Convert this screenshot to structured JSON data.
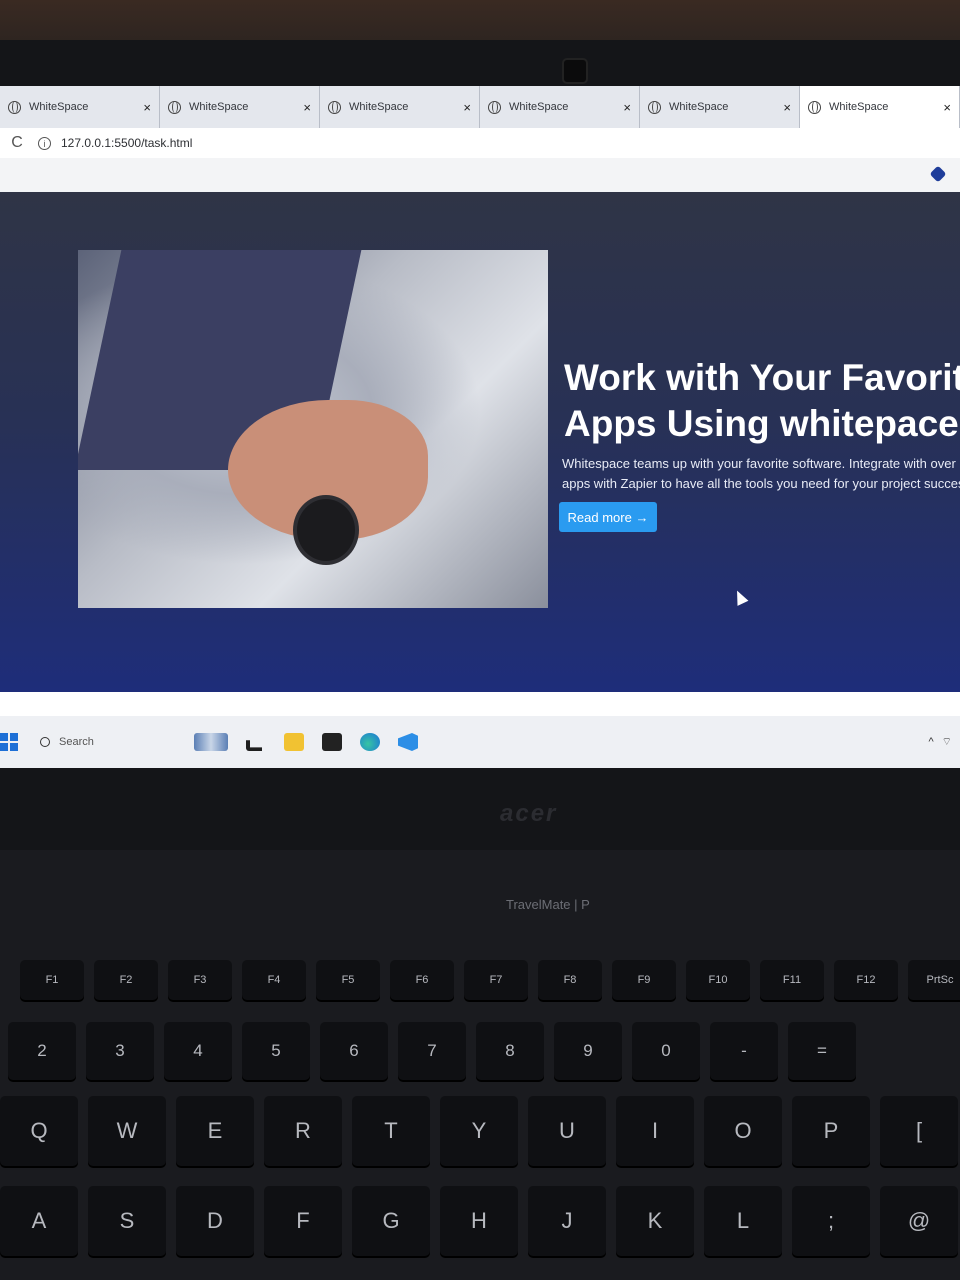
{
  "tabs": [
    {
      "title": "WhiteSpace",
      "active": false
    },
    {
      "title": "WhiteSpace",
      "active": false
    },
    {
      "title": "WhiteSpace",
      "active": false
    },
    {
      "title": "WhiteSpace",
      "active": false
    },
    {
      "title": "WhiteSpace",
      "active": false
    },
    {
      "title": "WhiteSpace",
      "active": true
    }
  ],
  "tab_close": "×",
  "address": {
    "url": "127.0.0.1:5500/task.html",
    "reload": "C",
    "info": "i"
  },
  "hero": {
    "title": "Work with Your Favorit\nApps Using whitepace",
    "text": "Whitespace teams up with your favorite software. Integrate with over apps with Zapier to have all the tools you need for your project succes",
    "button": "Read more →"
  },
  "taskbar": {
    "search": "Search",
    "icons": [
      "widgets-icon",
      "task-view-icon",
      "file-explorer-icon",
      "terminal-icon",
      "edge-icon",
      "vscode-icon"
    ],
    "tray": [
      "^",
      "wifi-icon"
    ]
  },
  "laptop": {
    "brand": "acer",
    "model": "TravelMate | P"
  },
  "keyboard": {
    "function_row": [
      "F1",
      "F2",
      "F3",
      "F4",
      "F5",
      "F6",
      "F7",
      "F8",
      "F9",
      "F10",
      "F11",
      "F12",
      "PrtSc"
    ],
    "number_row": [
      "2",
      "3",
      "4",
      "5",
      "6",
      "7",
      "8",
      "9",
      "0",
      "-",
      "="
    ],
    "top_row": [
      "Q",
      "W",
      "E",
      "R",
      "T",
      "Y",
      "U",
      "I",
      "O",
      "P",
      "["
    ],
    "home_row": [
      "A",
      "S",
      "D",
      "F",
      "G",
      "H",
      "J",
      "K",
      "L",
      ";",
      "@"
    ]
  },
  "colors": {
    "button": "#2a9bf0",
    "hero_bottom": "#1e2d7a",
    "accent": "#1d6fd6"
  }
}
